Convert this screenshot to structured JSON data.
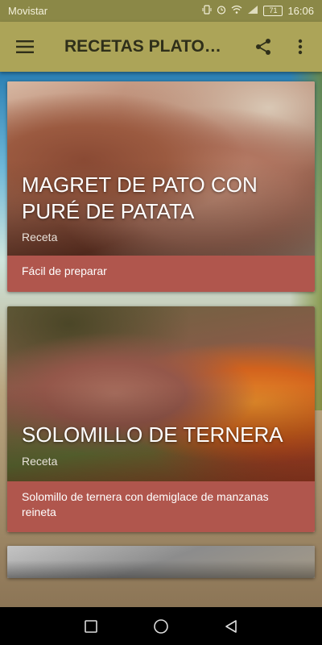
{
  "status_bar": {
    "carrier": "Movistar",
    "battery": "71",
    "time": "16:06",
    "icons": [
      "vibrate-icon",
      "alarm-icon",
      "wifi-icon",
      "signal-icon",
      "battery-icon"
    ]
  },
  "app_bar": {
    "title": "RECETAS PLATOS...",
    "actions": [
      "share-icon",
      "more-vert-icon"
    ]
  },
  "recipes": [
    {
      "title": "MAGRET DE PATO CON PURÉ DE PATATA",
      "subtitle": "Receta",
      "description": "Fácil de preparar"
    },
    {
      "title": "SOLOMILLO DE TERNERA",
      "subtitle": "Receta",
      "description": "Solomillo de ternera con demiglace de manzanas reineta"
    }
  ],
  "nav_bar": [
    "recents-icon",
    "home-icon",
    "back-icon"
  ],
  "colors": {
    "status_bar": "#8b8847",
    "app_bar": "#aca458",
    "card_footer": "#b0564d"
  }
}
